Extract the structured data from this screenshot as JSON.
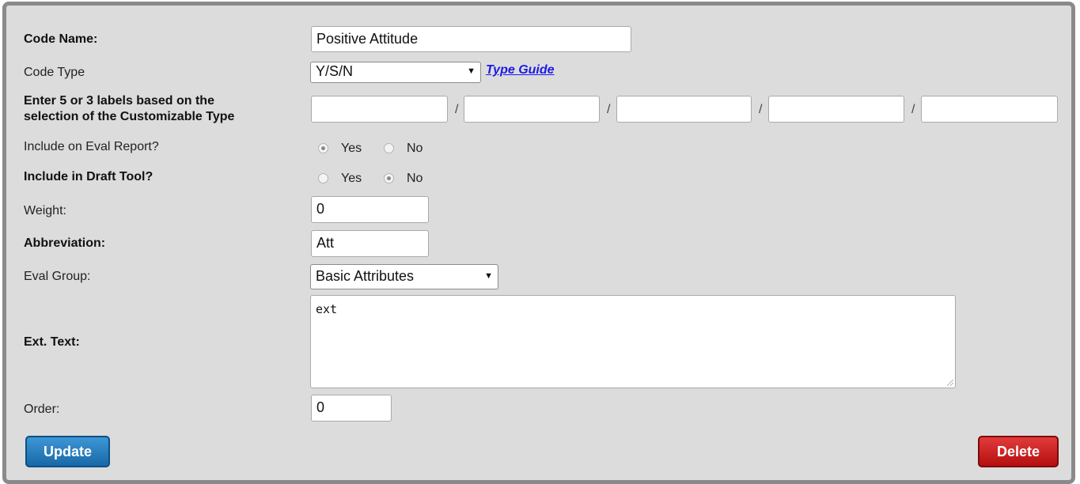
{
  "form": {
    "code_name": {
      "label": "Code Name:",
      "value": "Positive Attitude"
    },
    "code_type": {
      "label": "Code Type",
      "value": "Y/S/N",
      "link": "Type Guide"
    },
    "custom_labels": {
      "label_line1": "Enter 5 or 3 labels based on the",
      "label_line2": "selection of the Customizable Type",
      "values": [
        "",
        "",
        "",
        "",
        ""
      ],
      "separator": "/"
    },
    "eval_report": {
      "label": "Include on Eval Report?",
      "yes": "Yes",
      "no": "No",
      "selected": "Yes"
    },
    "draft_tool": {
      "label": "Include in Draft Tool?",
      "yes": "Yes",
      "no": "No",
      "selected": "No"
    },
    "weight": {
      "label": "Weight:",
      "value": "0"
    },
    "abbreviation": {
      "label": "Abbreviation:",
      "value": "Att"
    },
    "eval_group": {
      "label": "Eval Group:",
      "value": "Basic Attributes"
    },
    "ext_text": {
      "label": "Ext. Text:",
      "value": "ext"
    },
    "order": {
      "label": "Order:",
      "value": "0"
    }
  },
  "buttons": {
    "update": "Update",
    "delete": "Delete"
  },
  "colors": {
    "update": "#1f73b7",
    "delete": "#c91818",
    "link": "#1a1ae6",
    "panel": "#dcdcdc"
  }
}
